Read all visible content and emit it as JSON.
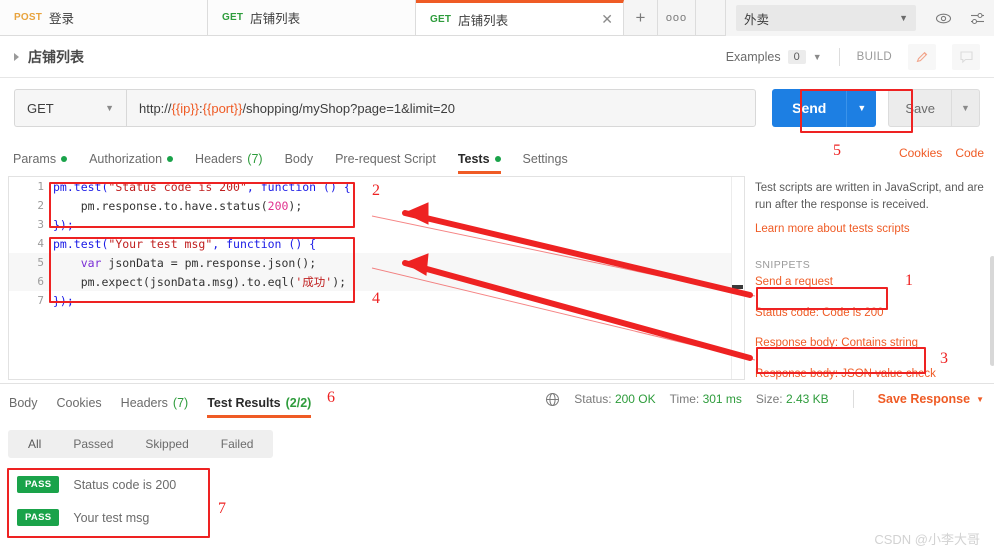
{
  "tabs": [
    {
      "method": "POST",
      "method_class": "post",
      "name": "登录",
      "active": false
    },
    {
      "method": "GET",
      "method_class": "get",
      "name": "店铺列表",
      "active": false
    },
    {
      "method": "GET",
      "method_class": "get",
      "name": "店铺列表",
      "active": true
    }
  ],
  "tabbar": {
    "new_tab_label": "+",
    "more_label": "ooo",
    "close_label": "✕"
  },
  "environment": {
    "selected": "外卖",
    "chevron": "▼",
    "eye_icon": "eye-icon",
    "settings_icon": "sliders-icon"
  },
  "breadcrumb": {
    "title": "店铺列表",
    "examples_label": "Examples",
    "examples_count": "0",
    "build_label": "BUILD"
  },
  "request": {
    "method": "GET",
    "url_prefix": "http://",
    "url_var1": "{{ip}}",
    "url_sep": ":",
    "url_var2": "{{port}}",
    "url_suffix": "/shopping/myShop?page=1&limit=20",
    "url_full": "http://{{ip}}:{{port}}/shopping/myShop?page=1&limit=20",
    "send_label": "Send",
    "save_label": "Save",
    "cookies_label": "Cookies",
    "code_label": "Code"
  },
  "request_tabs": [
    {
      "label": "Params",
      "dot": true,
      "count": "",
      "active": false
    },
    {
      "label": "Authorization",
      "dot": true,
      "count": "",
      "active": false
    },
    {
      "label": "Headers",
      "dot": false,
      "count": "(7)",
      "active": false
    },
    {
      "label": "Body",
      "dot": false,
      "count": "",
      "active": false
    },
    {
      "label": "Pre-request Script",
      "dot": false,
      "count": "",
      "active": false
    },
    {
      "label": "Tests",
      "dot": true,
      "count": "",
      "active": true
    },
    {
      "label": "Settings",
      "dot": false,
      "count": "",
      "active": false
    }
  ],
  "code": {
    "lines": [
      {
        "n": "1",
        "tokens": [
          {
            "t": "pm.test(",
            "c": "k-fn"
          },
          {
            "t": "\"Status code is 200\"",
            "c": "k-str"
          },
          {
            "t": ", function () {",
            "c": "k-fn"
          }
        ]
      },
      {
        "n": "2",
        "tokens": [
          {
            "t": "    pm.response.to.have.status(",
            "c": "k-pl"
          },
          {
            "t": "200",
            "c": "k-num"
          },
          {
            "t": ");",
            "c": "k-pl"
          }
        ]
      },
      {
        "n": "3",
        "tokens": [
          {
            "t": "});",
            "c": "k-fn"
          }
        ]
      },
      {
        "n": "4",
        "tokens": [
          {
            "t": "pm.test(",
            "c": "k-fn"
          },
          {
            "t": "\"Your test msg\"",
            "c": "k-str"
          },
          {
            "t": ", function () {",
            "c": "k-fn"
          }
        ]
      },
      {
        "n": "5",
        "tokens": [
          {
            "t": "    ",
            "c": "k-pl"
          },
          {
            "t": "var",
            "c": "k-kw"
          },
          {
            "t": " jsonData = pm.response.json();",
            "c": "k-pl"
          }
        ]
      },
      {
        "n": "6",
        "tokens": [
          {
            "t": "    pm.expect(jsonData.msg).to.eql(",
            "c": "k-pl"
          },
          {
            "t": "'成功'",
            "c": "k-str"
          },
          {
            "t": ");",
            "c": "k-pl"
          }
        ]
      },
      {
        "n": "7",
        "tokens": [
          {
            "t": "});",
            "c": "k-fn"
          }
        ]
      }
    ]
  },
  "snippets": {
    "description": "Test scripts are written in JavaScript, and are run after the response is received.",
    "learn_more": "Learn more about tests scripts",
    "header": "SNIPPETS",
    "items": [
      "Send a request",
      "Status code: Code is 200",
      "Response body: Contains string",
      "Response body: JSON value check"
    ]
  },
  "response_tabs": [
    {
      "label": "Body",
      "count": "",
      "active": false
    },
    {
      "label": "Cookies",
      "count": "",
      "active": false
    },
    {
      "label": "Headers",
      "count": "(7)",
      "active": false
    },
    {
      "label": "Test Results",
      "count": "(2/2)",
      "active": true
    }
  ],
  "response_meta": {
    "globe_icon": "globe-icon",
    "status_label": "Status:",
    "status_value": "200 OK",
    "time_label": "Time:",
    "time_value": "301 ms",
    "size_label": "Size:",
    "size_value": "2.43 KB",
    "save_response": "Save Response",
    "save_response_chevron": "▼"
  },
  "test_filters": [
    {
      "label": "All",
      "active": true
    },
    {
      "label": "Passed",
      "active": false
    },
    {
      "label": "Skipped",
      "active": false
    },
    {
      "label": "Failed",
      "active": false
    }
  ],
  "test_results": [
    {
      "status": "PASS",
      "name": "Status code is 200"
    },
    {
      "status": "PASS",
      "name": "Your test msg"
    }
  ],
  "annotations": {
    "numbers": [
      "1",
      "2",
      "3",
      "4",
      "5",
      "6",
      "7"
    ]
  },
  "watermark": "CSDN @小李大哥",
  "colors": {
    "accent_orange": "#ef5b25",
    "send_blue": "#1d7fe3",
    "pass_green": "#1aa34a",
    "annotation_red": "#ee2222"
  }
}
